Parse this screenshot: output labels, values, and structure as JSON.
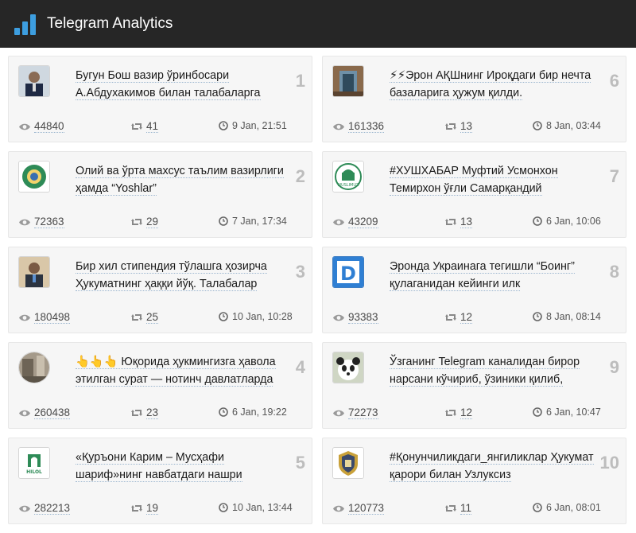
{
  "header": {
    "title": "Telegram Analytics"
  },
  "posts": [
    {
      "rank": "1",
      "text": "Бугун Бош вазир ўринбосари А.Абдухакимов билан талабаларга",
      "views": "44840",
      "reposts": "41",
      "date": "9 Jan, 21:51",
      "thumb": "portrait"
    },
    {
      "rank": "6",
      "text": "⚡⚡Эрон АҚШнинг Ироқдаги бир нечта базаларига ҳужум қилди.",
      "views": "161336",
      "reposts": "13",
      "date": "8 Jan, 03:44",
      "thumb": "building"
    },
    {
      "rank": "2",
      "text": "Олий ва ўрта махсус таълим вазирлиги ҳамда “Yoshlar”",
      "views": "72363",
      "reposts": "29",
      "date": "7 Jan, 17:34",
      "thumb": "emblem"
    },
    {
      "rank": "7",
      "text": "#ХУШХАБАР Муфтий Усмонхон Темирхон ўғли Самарқандий",
      "views": "43209",
      "reposts": "13",
      "date": "6 Jan, 10:06",
      "thumb": "muslim",
      "thumb_label": "MUSLIMUZ"
    },
    {
      "rank": "3",
      "text": "Бир хил стипендия тўлашга ҳозирча Ҳукуматнинг ҳаққи йўқ. Талабалар",
      "views": "180498",
      "reposts": "25",
      "date": "10 Jan, 10:28",
      "thumb": "portrait2"
    },
    {
      "rank": "8",
      "text": "Эронда Украинага тегишли “Боинг” қулаганидан кейинги илк",
      "views": "93383",
      "reposts": "12",
      "date": "8 Jan, 08:14",
      "thumb": "letter-d",
      "thumb_label": "D"
    },
    {
      "rank": "4",
      "text": "👆👆👆 Юқорида ҳукмингизга ҳавола этилган сурат — нотинч давлатларда",
      "views": "260438",
      "reposts": "23",
      "date": "6 Jan, 19:22",
      "thumb": "photo"
    },
    {
      "rank": "9",
      "text": "Ўзганинг Telegram каналидан бирор нарсани кўчириб, ўзиники қилиб,",
      "views": "72273",
      "reposts": "12",
      "date": "6 Jan, 10:47",
      "thumb": "panda"
    },
    {
      "rank": "5",
      "text": "«Қуръони Карим – Мусҳафи шариф»нинг навбатдаги нашри",
      "views": "282213",
      "reposts": "19",
      "date": "10 Jan, 13:44",
      "thumb": "hilol",
      "thumb_label": "HILOL"
    },
    {
      "rank": "10",
      "text": "#Қонунчиликдаги_янгиликлар Ҳукумат қарори билан Узлуксиз",
      "views": "120773",
      "reposts": "11",
      "date": "6 Jan, 08:01",
      "thumb": "shield"
    }
  ],
  "icons": {
    "views": "eye-icon",
    "reposts": "repost-icon",
    "date": "clock-icon",
    "logo": "bar-chart-icon"
  },
  "colors": {
    "header_bg": "#262626",
    "accent": "#3d9ee0",
    "card_bg": "#f6f6f6",
    "rank": "#bdbdbd"
  }
}
